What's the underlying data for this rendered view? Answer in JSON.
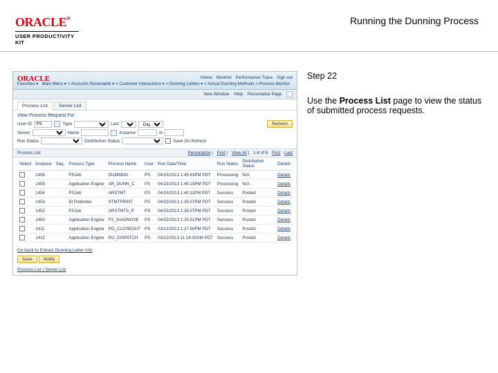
{
  "doc": {
    "title": "Running the Dunning Process",
    "logo_sub": "USER PRODUCTIVITY KIT",
    "logo_brand": "ORACLE"
  },
  "sidebar": {
    "step": "Step 22",
    "instruction_pre": "Use the ",
    "instruction_bold": "Process List",
    "instruction_post": " page to view the status of submitted process requests."
  },
  "mock": {
    "brand": "ORACLE",
    "top_nav": [
      "Favorites ▾",
      "Main Menu ▾",
      "Accounts Receivable ▾",
      "Customer Interactions ▾",
      "Dunning Letters ▾",
      "Actual Dunning Methods",
      "Process Monitor"
    ],
    "top_links_label_home": "Home",
    "top_links_label_worklist": "Worklist",
    "top_links_label_perf": "Performance Trace",
    "top_links_label_signout": "Sign out",
    "link_row": [
      "New Window",
      "Help",
      "Personalize Page"
    ],
    "tab_active": "Process List",
    "tab_idle": "Server List",
    "section_title": "View Process Request For",
    "filters": {
      "user_label": "User ID",
      "user_value": "PS",
      "type_label": "Type",
      "type_value": "",
      "last_label": "Last",
      "last_value": "1",
      "last_unit": "Days",
      "refresh": "Refresh",
      "server_label": "Server",
      "server_value": "",
      "name_label": "Name",
      "name_value": "",
      "instance_label": "Instance",
      "instance_to": "to",
      "run_status_label": "Run Status",
      "run_status_value": "",
      "dist_status_label": "Distribution Status",
      "dist_status_value": "",
      "save_on_refresh": "Save On Refresh"
    },
    "grid": {
      "title": "Process List",
      "nav": [
        "Personalize",
        "Find",
        "View All",
        "1-8 of 8",
        "First",
        "Last"
      ],
      "cols": [
        "Select",
        "Instance",
        "Seq.",
        "Process Type",
        "Process Name",
        "User",
        "Run Date/Time",
        "Run Status",
        "Distribution Status",
        "Details"
      ],
      "rows": [
        {
          "inst": "1456",
          "seq": "",
          "ptype": "PSJob",
          "pname": "DUNNING",
          "user": "PS",
          "dt": "04/15/2013 1:45:43PM PDT",
          "run": "Processing",
          "dist": "N/A",
          "det": "Details"
        },
        {
          "inst": "1455",
          "seq": "",
          "ptype": "Application Engine",
          "pname": "AR_DUNN_C",
          "user": "PS",
          "dt": "04/15/2013 1:45:19PM PDT",
          "run": "Processing",
          "dist": "N/A",
          "det": "Details"
        },
        {
          "inst": "1454",
          "seq": "",
          "ptype": "PSJob",
          "pname": "ARSTMT",
          "user": "PS",
          "dt": "04/15/2013 1:40:11PM PDT",
          "run": "Success",
          "dist": "Posted",
          "det": "Details"
        },
        {
          "inst": "1453",
          "seq": "",
          "ptype": "BI Publisher",
          "pname": "STMTPRINT",
          "user": "PS",
          "dt": "04/15/2013 1:35:07PM PDT",
          "run": "Success",
          "dist": "Posted",
          "det": "Details"
        },
        {
          "inst": "1452",
          "seq": "",
          "ptype": "PSJob",
          "pname": "ARSTMTS_P",
          "user": "PS",
          "dt": "04/15/2013 1:35:07PM PDT",
          "run": "Success",
          "dist": "Posted",
          "det": "Details"
        },
        {
          "inst": "1450",
          "seq": "",
          "ptype": "Application Engine",
          "pname": "FS_DIAGNOSE",
          "user": "PS",
          "dt": "04/15/2013 1:25:51PM PDT",
          "run": "Success",
          "dist": "Posted",
          "det": "Details"
        },
        {
          "inst": "1411",
          "seq": "",
          "ptype": "Application Engine",
          "pname": "PO_CLOSEOUT",
          "user": "PS",
          "dt": "03/12/2013 1:27:50PM PDT",
          "run": "Success",
          "dist": "Posted",
          "det": "Details"
        },
        {
          "inst": "1412",
          "seq": "",
          "ptype": "Application Engine",
          "pname": "PO_DISPATCH",
          "user": "PS",
          "dt": "03/12/2013 11:14:00AM PDT",
          "run": "Success",
          "dist": "Posted",
          "det": "Details"
        }
      ]
    },
    "footer": {
      "goback": "Go back to Extract Dunning Letter Info",
      "save": "Save",
      "notify": "Notify",
      "bottom_links": "Process List | Server List"
    }
  }
}
